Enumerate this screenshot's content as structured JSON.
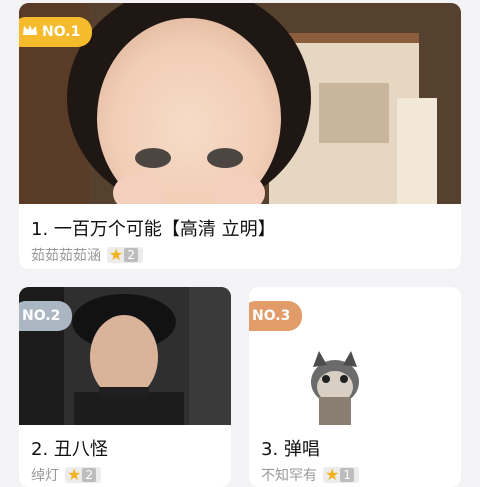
{
  "cards": [
    {
      "rank": "NO.1",
      "title": "1. 一百万个可能【高清 立明】",
      "author": "茹茹茹茹涵",
      "star_count": "2",
      "badge_color": "#f6bb2c"
    },
    {
      "rank": "NO.2",
      "title": "2. 丑八怪",
      "author": "绰灯",
      "star_count": "2",
      "badge_color": "#aab7c3"
    },
    {
      "rank": "NO.3",
      "title": "3. 弹唱",
      "author": "不知罕有",
      "star_count": "1",
      "badge_color": "#e29c6a"
    }
  ],
  "icons": {
    "crown": "crown-icon",
    "star": "star-icon"
  }
}
